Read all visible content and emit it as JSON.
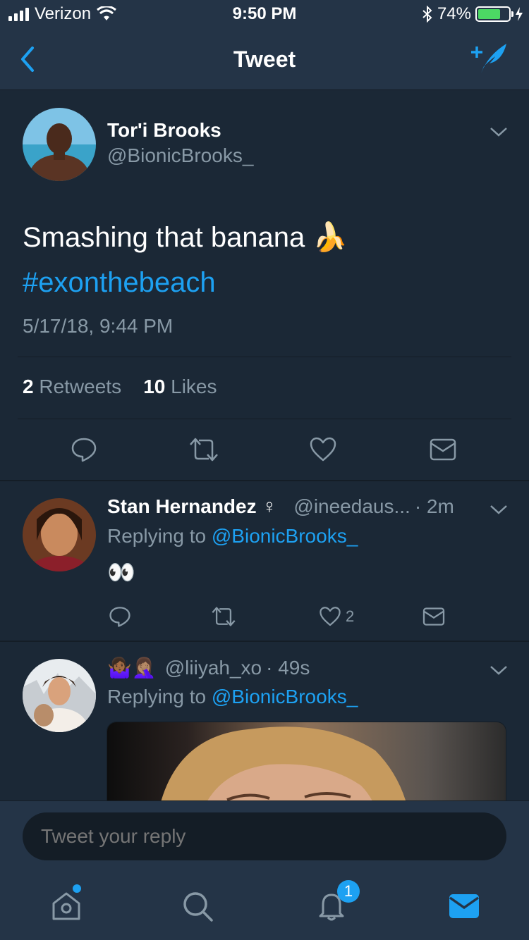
{
  "status_bar": {
    "carrier": "Verizon",
    "time": "9:50 PM",
    "battery": "74%",
    "battery_level": 0.74
  },
  "nav": {
    "title": "Tweet",
    "back_icon": "chevron-left-icon",
    "compose_icon": "compose-feather-icon"
  },
  "main_tweet": {
    "name": "Tor'i Brooks",
    "handle": "@BionicBrooks_",
    "text": "Smashing that banana 🍌",
    "hashtag": "#exonthebeach",
    "date": "5/17/18, 9:44 PM",
    "retweets_count": "2",
    "retweets_label": " Retweets",
    "likes_count": "10",
    "likes_label": " Likes"
  },
  "replies": [
    {
      "name": "Stan Hernandez ♀",
      "handle": "@ineedaus...",
      "time": "· 2m",
      "replying_prefix": "Replying to ",
      "replying_to": "@BionicBrooks_",
      "text": "👀",
      "like_count": "2"
    },
    {
      "name": "🤷🏾‍♀️🤦🏽‍♀️",
      "handle": "@liiyah_xo",
      "time": "· 49s",
      "replying_prefix": "Replying to ",
      "replying_to": "@BionicBrooks_"
    }
  ],
  "reply_bar": {
    "placeholder": "Tweet your reply"
  },
  "tab_bar": {
    "notifications_badge": "1"
  },
  "colors": {
    "background": "#1b2836",
    "bar": "#243447",
    "accent": "#1da1f2",
    "muted": "#8899a6"
  }
}
